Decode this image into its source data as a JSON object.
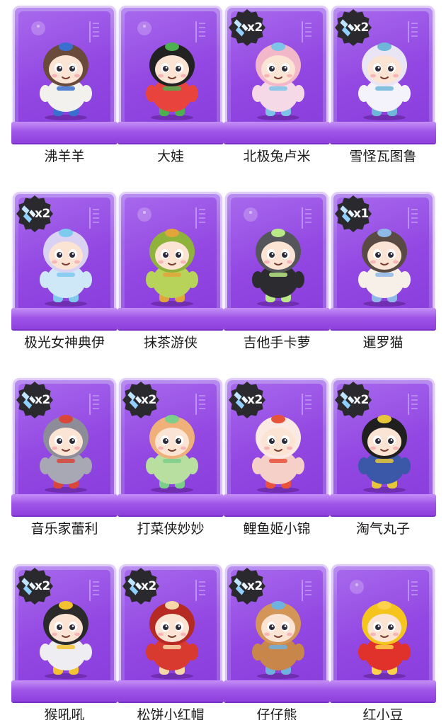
{
  "badge_icon": "crystal-shard-icon",
  "colors": {
    "box": "#9247e2",
    "badge_bg": "#2a2a2e",
    "label_text": "#1a1a1a"
  },
  "items": [
    {
      "name": "沸羊羊",
      "badge": "",
      "theme": {
        "body": "#f3f1ee",
        "head": "#6a4a3a",
        "accent": "#3a6fcf"
      },
      "icon": "sheep-figure-icon"
    },
    {
      "name": "大娃",
      "badge": "",
      "theme": {
        "body": "#e8443d",
        "head": "#222222",
        "accent": "#4caf50"
      },
      "icon": "calabash-boy-figure-icon"
    },
    {
      "name": "北极兔卢米",
      "badge": "x2",
      "theme": {
        "body": "#f6d9e6",
        "head": "#f2b7c9",
        "accent": "#7ec3e8"
      },
      "icon": "arctic-rabbit-figure-icon"
    },
    {
      "name": "雪怪瓦图鲁",
      "badge": "x2",
      "theme": {
        "body": "#f4f2fb",
        "head": "#e9e5f5",
        "accent": "#6fb7d8"
      },
      "icon": "snow-monster-figure-icon"
    },
    {
      "name": "极光女神典伊",
      "badge": "x2",
      "theme": {
        "body": "#cfe8f7",
        "head": "#d9d2f2",
        "accent": "#7fc8ee"
      },
      "icon": "aurora-goddess-figure-icon"
    },
    {
      "name": "抹茶游侠",
      "badge": "",
      "theme": {
        "body": "#b8d35a",
        "head": "#8fb33a",
        "accent": "#e2a53a"
      },
      "icon": "matcha-ranger-figure-icon"
    },
    {
      "name": "吉他手卡萝",
      "badge": "",
      "theme": {
        "body": "#2c2c30",
        "head": "#55565c",
        "accent": "#b8e986"
      },
      "icon": "guitarist-figure-icon"
    },
    {
      "name": "暹罗猫",
      "badge": "x1",
      "theme": {
        "body": "#f6f0e8",
        "head": "#5a4a44",
        "accent": "#8fb8e8"
      },
      "icon": "siamese-cat-figure-icon"
    },
    {
      "name": "音乐家蕾利",
      "badge": "x2",
      "theme": {
        "body": "#a8a8b4",
        "head": "#8d8d99",
        "accent": "#d9473a"
      },
      "icon": "musician-figure-icon"
    },
    {
      "name": "打菜侠妙妙",
      "badge": "x2",
      "theme": {
        "body": "#b8dfa0",
        "head": "#f0b07a",
        "accent": "#7ccf8a"
      },
      "icon": "vegetable-hero-figure-icon"
    },
    {
      "name": "鲤鱼姬小锦",
      "badge": "x2",
      "theme": {
        "body": "#f5d0c8",
        "head": "#fbe9e3",
        "accent": "#e8523a"
      },
      "icon": "koi-princess-figure-icon"
    },
    {
      "name": "淘气丸子",
      "badge": "x2",
      "theme": {
        "body": "#3a57a8",
        "head": "#1f1f1f",
        "accent": "#e8c63a"
      },
      "icon": "naughty-wanzi-figure-icon"
    },
    {
      "name": "猴吼吼",
      "badge": "x2",
      "theme": {
        "body": "#eeeef2",
        "head": "#2a2a2a",
        "accent": "#f2c230"
      },
      "icon": "monkey-astronaut-figure-icon"
    },
    {
      "name": "松饼小红帽",
      "badge": "x2",
      "theme": {
        "body": "#d93a2f",
        "head": "#b52a22",
        "accent": "#f6d7a8"
      },
      "icon": "muffin-red-hood-figure-icon"
    },
    {
      "name": "仔仔熊",
      "badge": "x2",
      "theme": {
        "body": "#c8864a",
        "head": "#d49558",
        "accent": "#6fb2e0"
      },
      "icon": "teddy-bear-figure-icon"
    },
    {
      "name": "红小豆",
      "badge": "",
      "theme": {
        "body": "#e0322a",
        "head": "#f5c51e",
        "accent": "#ffd24a"
      },
      "icon": "red-bean-figure-icon"
    }
  ]
}
